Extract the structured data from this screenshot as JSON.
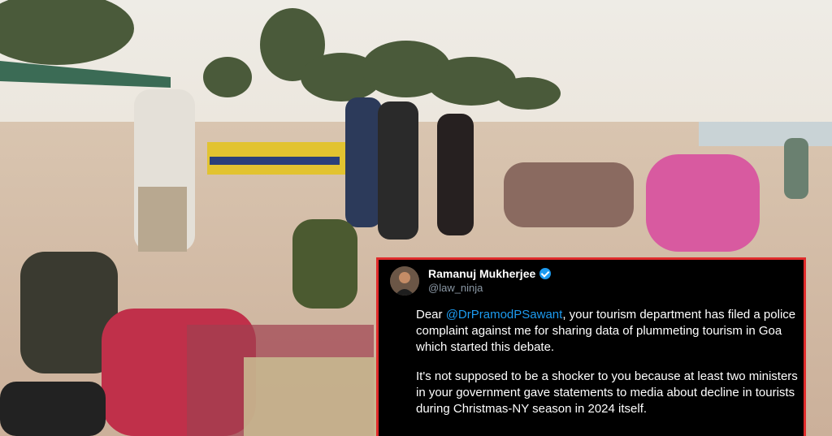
{
  "tweet": {
    "author_name": "Ramanuj Mukherjee",
    "handle": "@law_ninja",
    "verified": true,
    "para1_prefix": "Dear ",
    "mention": "@DrPramodPSawant",
    "para1_rest": ", your tourism department has filed a police complaint against me for sharing data of plummeting tourism in Goa which started this debate.",
    "para2": "It's not supposed to be a shocker to you because at least two ministers in your government gave statements to media about decline in tourists during Christmas-NY season in 2024 itself."
  },
  "colors": {
    "border": "#e02b2b",
    "mention": "#1d9bf0",
    "verified": "#1d9bf0"
  },
  "icons": [
    "verified-badge-icon"
  ]
}
